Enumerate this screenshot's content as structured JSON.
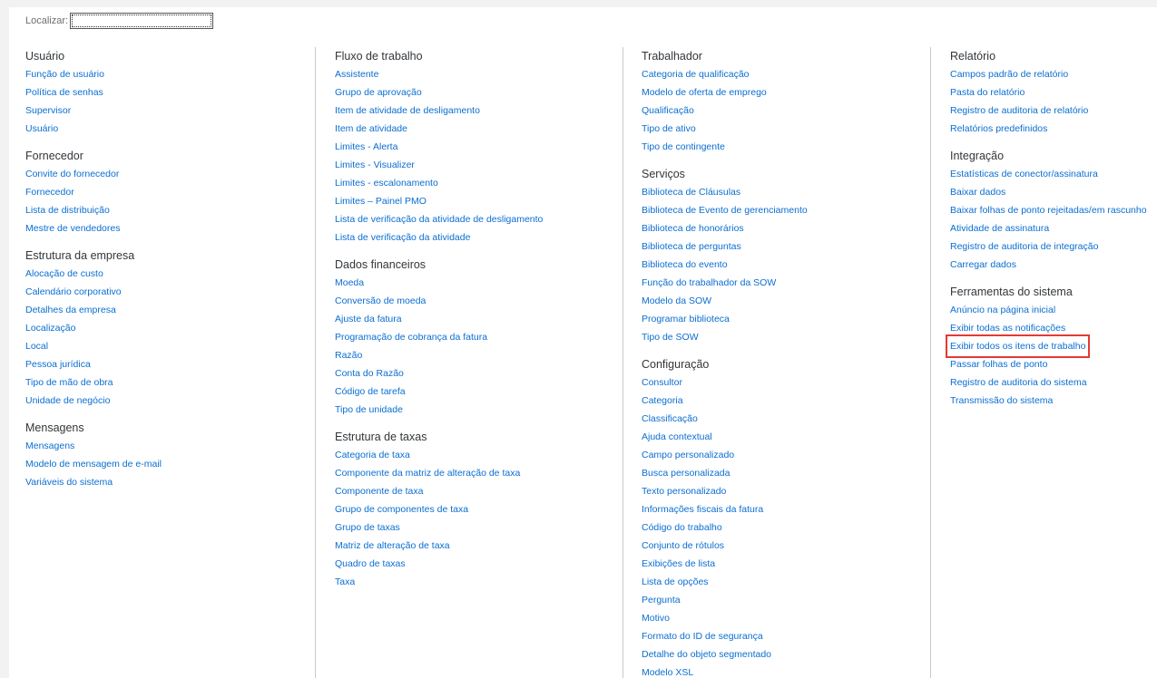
{
  "search": {
    "label": "Localizar:",
    "value": ""
  },
  "columns": [
    {
      "groups": [
        {
          "title": "Usuário",
          "items": [
            "Função de usuário",
            "Política de senhas",
            "Supervisor",
            "Usuário"
          ]
        },
        {
          "title": "Fornecedor",
          "items": [
            "Convite do fornecedor",
            "Fornecedor",
            "Lista de distribuição",
            "Mestre de vendedores"
          ]
        },
        {
          "title": "Estrutura da empresa",
          "items": [
            "Alocação de custo",
            "Calendário corporativo",
            "Detalhes da empresa",
            "Localização",
            "Local",
            "Pessoa jurídica",
            "Tipo de mão de obra",
            "Unidade de negócio"
          ]
        },
        {
          "title": "Mensagens",
          "items": [
            "Mensagens",
            "Modelo de mensagem de e-mail",
            "Variáveis do sistema"
          ]
        }
      ]
    },
    {
      "groups": [
        {
          "title": "Fluxo de trabalho",
          "items": [
            "Assistente",
            "Grupo de aprovação",
            "Item de atividade de desligamento",
            "Item de atividade",
            "Limites - Alerta",
            "Limites - Visualizer",
            "Limites - escalonamento",
            "Limites – Painel PMO",
            "Lista de verificação da atividade de desligamento",
            "Lista de verificação da atividade"
          ]
        },
        {
          "title": "Dados financeiros",
          "items": [
            "Moeda",
            "Conversão de moeda",
            "Ajuste da fatura",
            "Programação de cobrança da fatura",
            "Razão",
            "Conta do Razão",
            "Código de tarefa",
            "Tipo de unidade"
          ]
        },
        {
          "title": "Estrutura de taxas",
          "items": [
            "Categoria de taxa",
            "Componente da matriz de alteração de taxa",
            "Componente de taxa",
            "Grupo de componentes de taxa",
            "Grupo de taxas",
            "Matriz de alteração de taxa",
            "Quadro de taxas",
            "Taxa"
          ]
        }
      ]
    },
    {
      "groups": [
        {
          "title": "Trabalhador",
          "items": [
            "Categoria de qualificação",
            "Modelo de oferta de emprego",
            "Qualificação",
            "Tipo de ativo",
            "Tipo de contingente"
          ]
        },
        {
          "title": "Serviços",
          "items": [
            "Biblioteca de Cláusulas",
            "Biblioteca de Evento de gerenciamento",
            "Biblioteca de honorários",
            "Biblioteca de perguntas",
            "Biblioteca do evento",
            "Função do trabalhador da SOW",
            "Modelo da SOW",
            "Programar biblioteca",
            "Tipo de SOW"
          ]
        },
        {
          "title": "Configuração",
          "items": [
            "Consultor",
            "Categoria",
            "Classificação",
            "Ajuda contextual",
            "Campo personalizado",
            "Busca personalizada",
            "Texto personalizado",
            "Informações fiscais da fatura",
            "Código do trabalho",
            "Conjunto de rótulos",
            "Exibições de lista",
            "Lista de opções",
            "Pergunta",
            "Motivo",
            "Formato do ID de segurança",
            "Detalhe do objeto segmentado",
            "Modelo XSL"
          ]
        }
      ]
    },
    {
      "groups": [
        {
          "title": "Relatório",
          "items": [
            "Campos padrão de relatório",
            "Pasta do relatório",
            "Registro de auditoria de relatório",
            "Relatórios predefinidos"
          ]
        },
        {
          "title": "Integração",
          "items": [
            "Estatísticas de conector/assinatura",
            "Baixar dados",
            "Baixar folhas de ponto rejeitadas/em rascunho",
            "Atividade de assinatura",
            "Registro de auditoria de integração",
            "Carregar dados"
          ]
        },
        {
          "title": "Ferramentas do sistema",
          "items": [
            "Anúncio na página inicial",
            "Exibir todas as notificações",
            "Exibir todos os itens de trabalho",
            "Passar folhas de ponto",
            "Registro de auditoria do sistema",
            "Transmissão do sistema"
          ],
          "highlighted": "Exibir todos os itens de trabalho"
        }
      ]
    }
  ],
  "colors": {
    "link": "#0a6ed1",
    "heading": "#32363a",
    "highlight_border": "#e53935"
  }
}
